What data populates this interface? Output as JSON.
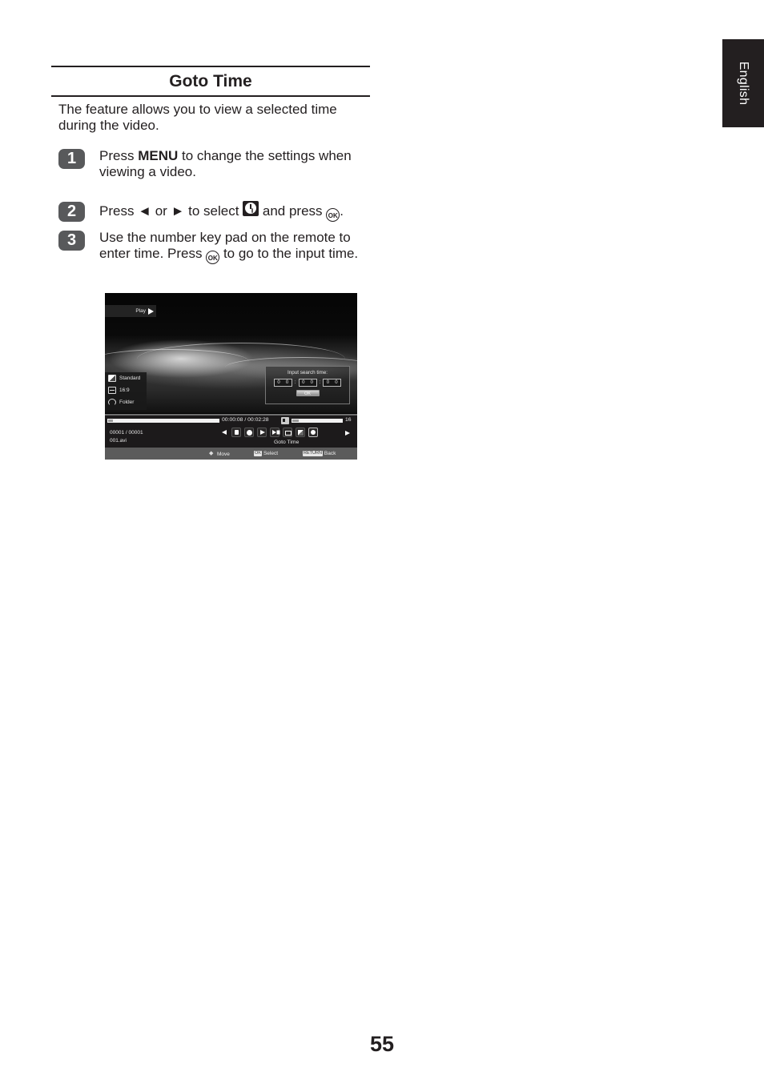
{
  "side_tab": {
    "language": "English"
  },
  "section": {
    "title": "Goto Time",
    "intro": "The feature allows you to view a selected time during the video."
  },
  "steps": [
    {
      "number": "1",
      "parts": [
        "Press ",
        "MENU",
        " to change the settings when viewing a video."
      ]
    },
    {
      "number": "2",
      "parts": [
        "Press ◄ or ► to select ",
        " and press ",
        "."
      ],
      "icon": "goto-time-icon",
      "ok_label": "OK"
    },
    {
      "number": "3",
      "parts": [
        "Use the number key pad on the remote to enter time. Press ",
        " to go to the input time."
      ],
      "ok_label": "OK"
    }
  ],
  "screen": {
    "play_status": "Play",
    "side_menu": [
      {
        "icon": "picture-mode-icon",
        "label": "Standard"
      },
      {
        "icon": "aspect-ratio-icon",
        "label": "16:9"
      },
      {
        "icon": "repeat-icon",
        "label": "Folder"
      }
    ],
    "search_dialog": {
      "label": "Input search time:",
      "fields": [
        [
          "0",
          "0"
        ],
        [
          "0",
          "0"
        ],
        [
          "0",
          "0"
        ]
      ],
      "separator": ":",
      "ok_label": "OK"
    },
    "progress": {
      "elapsed": "00:00:08",
      "total": "00:02:28",
      "time_text": "00:00:08 / 00:02:28",
      "fraction": 0.054
    },
    "volume": {
      "level": 16,
      "fraction": 0.16
    },
    "file_index": "00001 / 00001",
    "file_name": "001.avi",
    "control_icons": [
      "playlist-icon",
      "info-icon",
      "step-forward-icon",
      "next-icon",
      "aspect-icon",
      "picture-icon",
      "goto-time-icon"
    ],
    "selected_control_label": "Goto Time",
    "help": [
      {
        "key": "",
        "icon": "move-icon",
        "label": "Move"
      },
      {
        "key": "OK",
        "label": "Select"
      },
      {
        "key": "RETURN",
        "label": "Back"
      }
    ]
  },
  "page_number": "55"
}
